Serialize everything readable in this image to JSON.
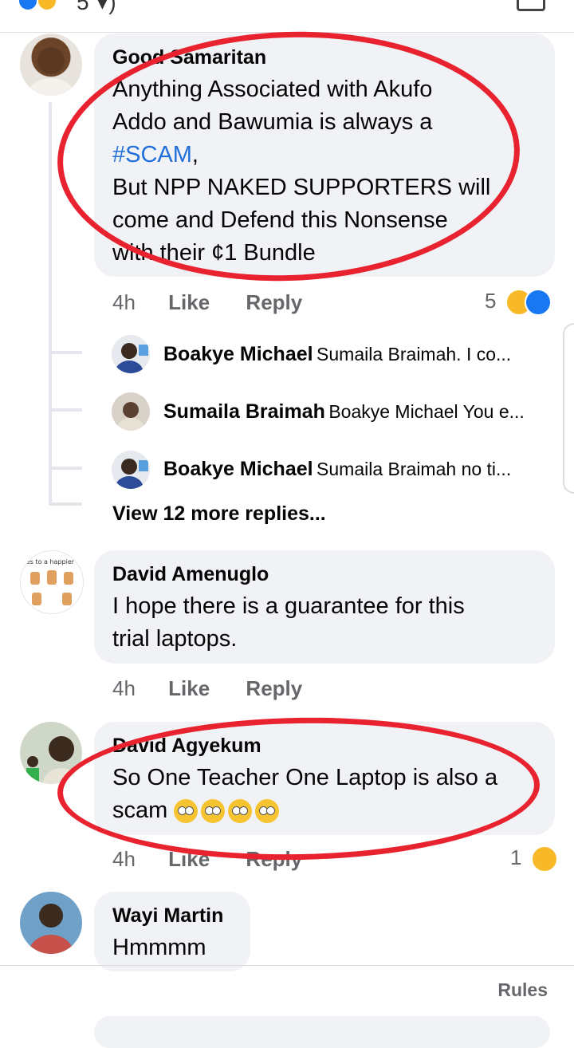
{
  "header": {
    "partial_text": "5 ▾) ",
    "icons": [
      "like-reaction",
      "haha-reaction"
    ]
  },
  "comments": [
    {
      "name": "Good Samaritan",
      "text_line1": "Anything Associated with Akufo",
      "text_line2": "Addo and Bawumia is always a",
      "hashtag": "#SCAM",
      "text_after_hashtag": ",",
      "text_line4": "But NPP NAKED SUPPORTERS will",
      "text_line5": "come and Defend this Nonsense",
      "text_line6": "with their ¢1 Bundle",
      "time": "4h",
      "like": "Like",
      "reply": "Reply",
      "reaction_count": "5",
      "reactions": [
        "haha",
        "like"
      ]
    },
    {
      "name": "David Amenuglo",
      "text_line1": "I hope there is a guarantee for this",
      "text_line2": "trial laptops.",
      "time": "4h",
      "like": "Like",
      "reply": "Reply",
      "avatar_caption": "rules to a happier life"
    },
    {
      "name": "David Agyekum",
      "text_line1": "So One Teacher One Laptop is also a",
      "text_line2": "scam",
      "emoji": "face-with-rolling-eyes",
      "time": "4h",
      "like": "Like",
      "reply": "Reply",
      "reaction_count": "1",
      "reactions": [
        "haha"
      ]
    },
    {
      "name": "Wayi Martin",
      "text_line1": "Hmmmm"
    }
  ],
  "replies": [
    {
      "name": "Boakye Michael",
      "snippet": "Sumaila Braimah. I co..."
    },
    {
      "name": "Sumaila Braimah",
      "snippet": "Boakye Michael You e..."
    },
    {
      "name": "Boakye Michael",
      "snippet": "Sumaila Braimah no ti..."
    }
  ],
  "view_more_replies": "View 12 more replies...",
  "footer": {
    "rules_label": "Rules"
  },
  "colors": {
    "annotation_red": "#e8222e",
    "hashtag_blue": "#216fdb",
    "meta_gray": "#65676b",
    "bubble_bg": "#f0f2f5"
  }
}
